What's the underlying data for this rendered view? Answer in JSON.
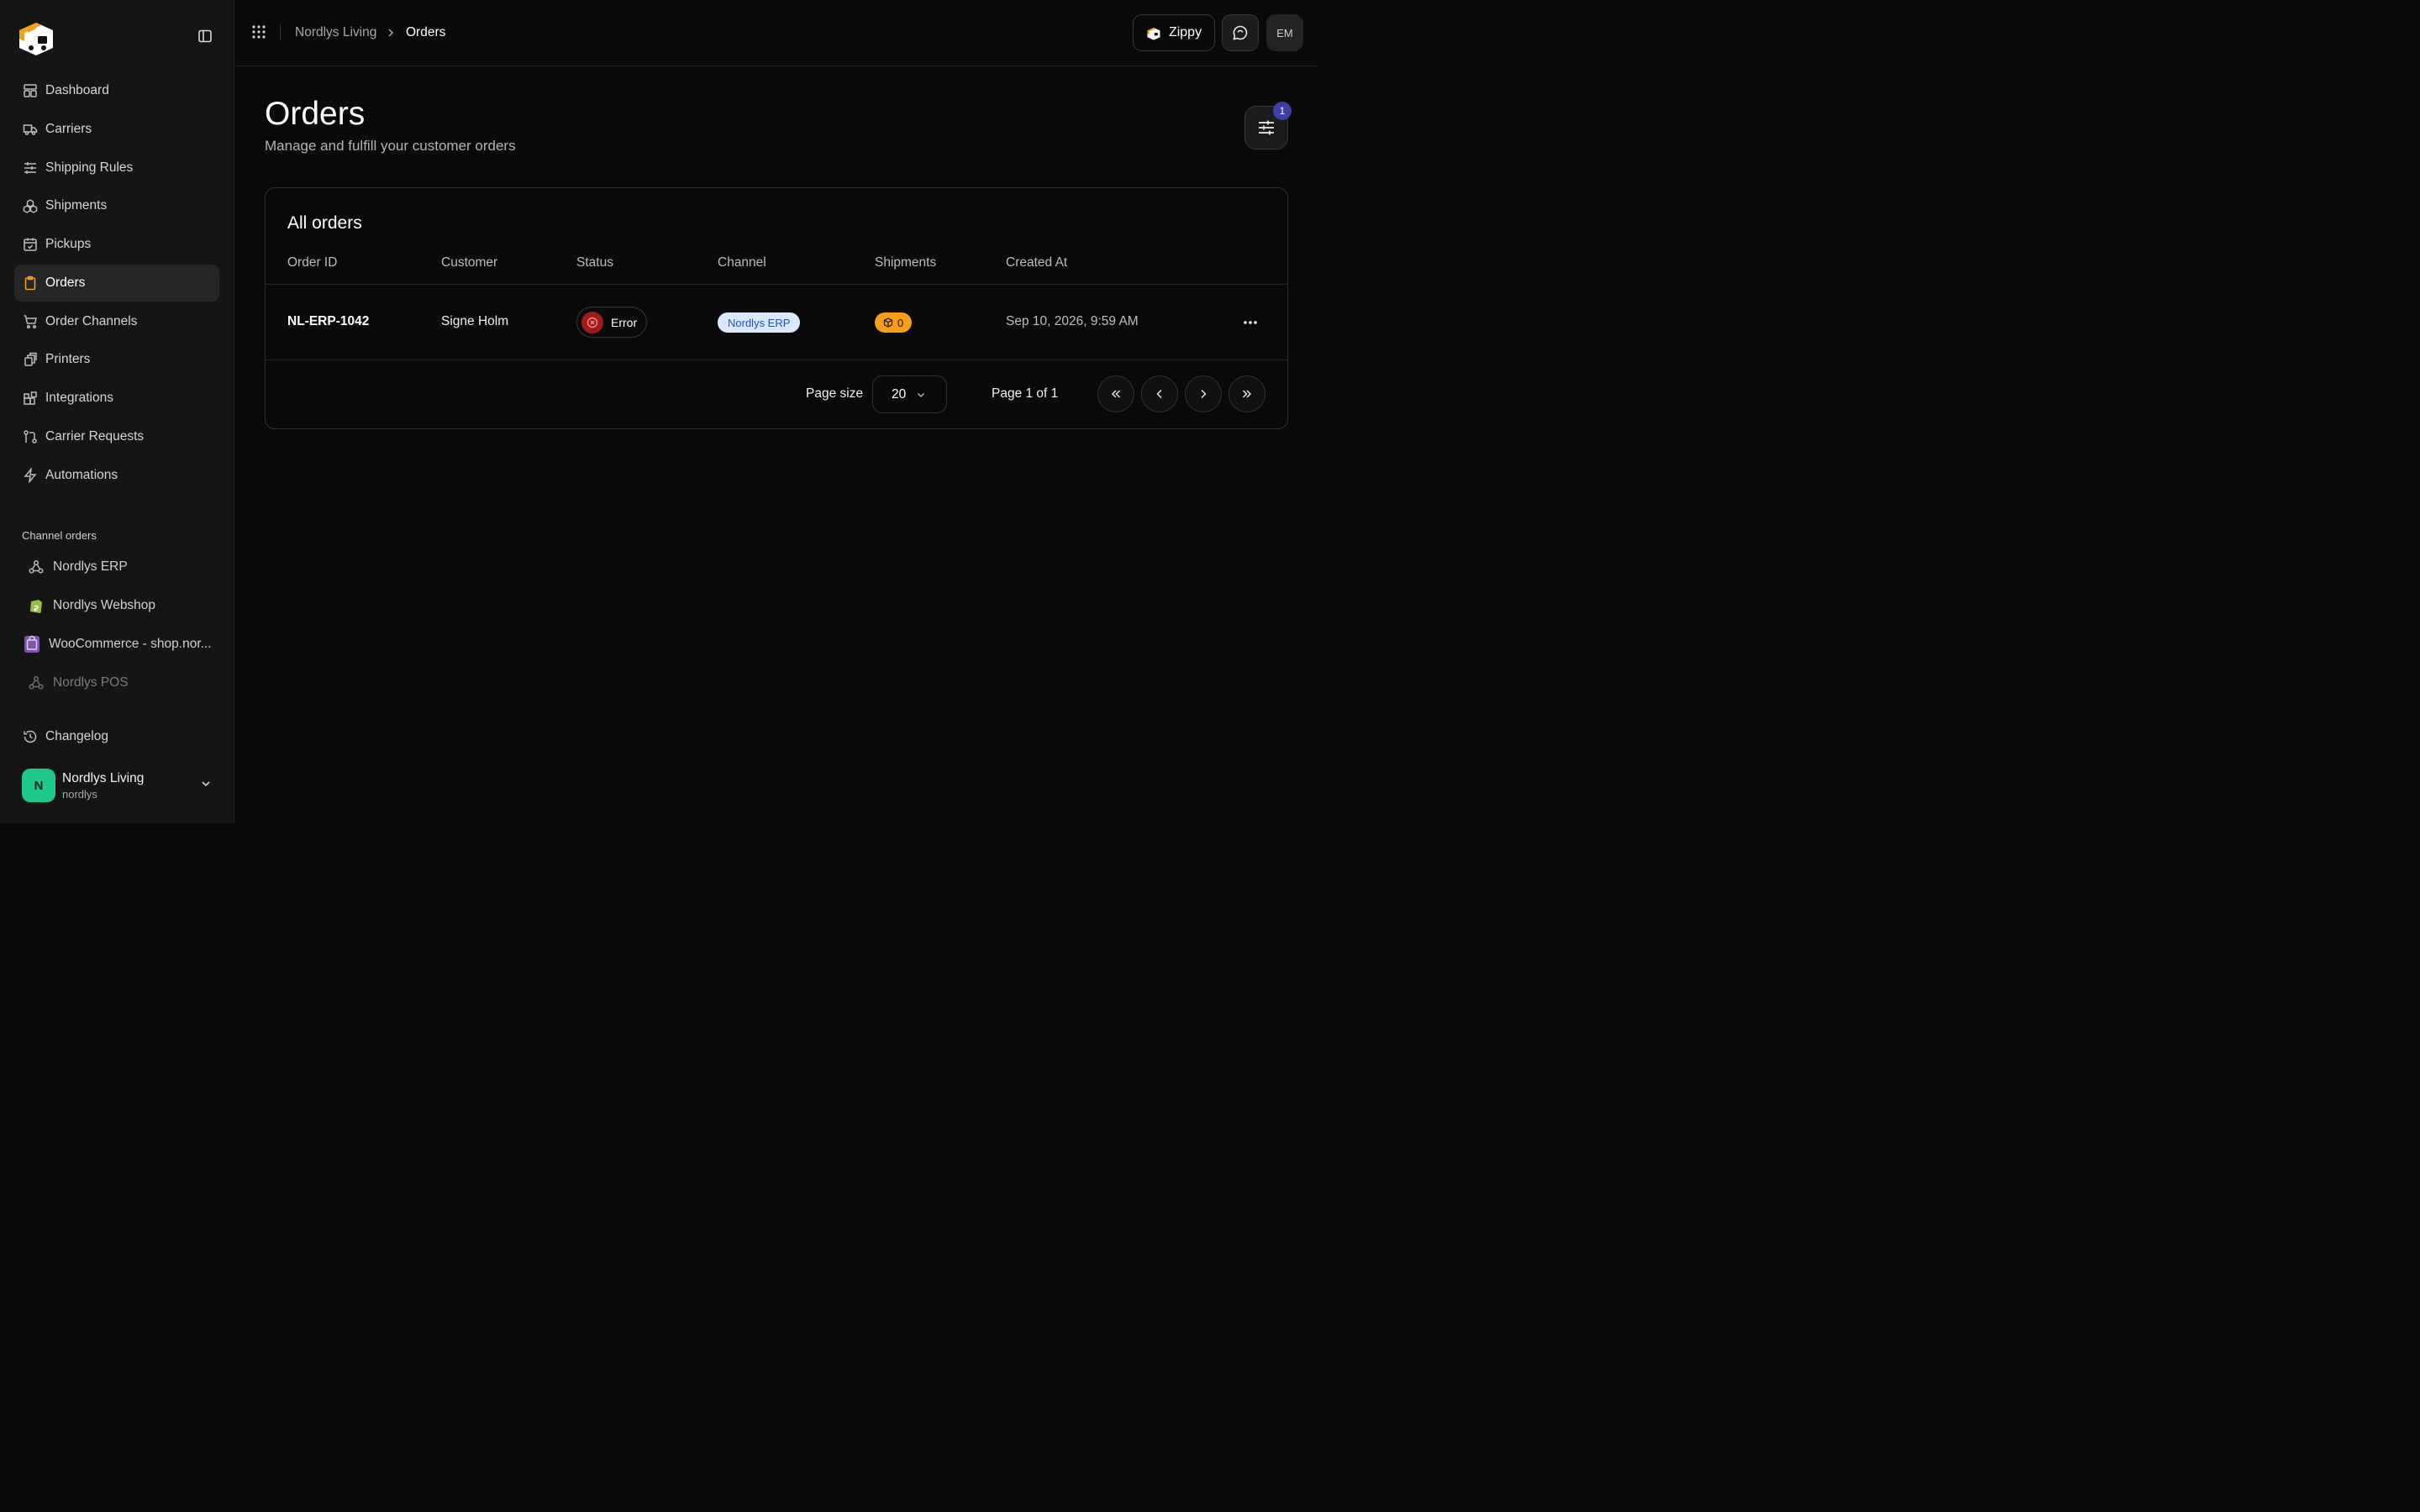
{
  "sidebar": {
    "toggle_icon": "sidebar-toggle-icon",
    "nav": [
      {
        "label": "Dashboard",
        "icon": "dashboard-icon"
      },
      {
        "label": "Carriers",
        "icon": "truck-icon"
      },
      {
        "label": "Shipping Rules",
        "icon": "sliders-icon"
      },
      {
        "label": "Shipments",
        "icon": "boxes-icon"
      },
      {
        "label": "Pickups",
        "icon": "calendar-check-icon"
      },
      {
        "label": "Orders",
        "icon": "clipboard-icon",
        "active": true
      },
      {
        "label": "Order Channels",
        "icon": "cart-icon"
      },
      {
        "label": "Printers",
        "icon": "printer-icon"
      },
      {
        "label": "Integrations",
        "icon": "blocks-icon"
      },
      {
        "label": "Carrier Requests",
        "icon": "git-pull-request-icon"
      },
      {
        "label": "Automations",
        "icon": "zap-icon"
      }
    ],
    "channel_section_label": "Channel orders",
    "channels": [
      {
        "label": "Nordlys ERP",
        "icon": "webhook-icon"
      },
      {
        "label": "Nordlys Webshop",
        "icon": "shopify-icon"
      },
      {
        "label": "WooCommerce - shop.nor...",
        "icon": "woocommerce-icon"
      },
      {
        "label": "Nordlys POS",
        "icon": "webhook-icon"
      }
    ],
    "changelog_label": "Changelog",
    "account": {
      "initial": "N",
      "name": "Nordlys Living",
      "handle": "nordlys",
      "avatar_color": "#1fc98a"
    }
  },
  "topbar": {
    "breadcrumb": [
      "Nordlys Living",
      "Orders"
    ],
    "app_button_label": "Zippy",
    "user_initials": "EM"
  },
  "page": {
    "title": "Orders",
    "subtitle": "Manage and fulfill your customer orders",
    "filter_count": "1"
  },
  "table": {
    "title": "All orders",
    "columns": [
      "Order ID",
      "Customer",
      "Status",
      "Channel",
      "Shipments",
      "Created At"
    ],
    "rows": [
      {
        "order_id": "NL-ERP-1042",
        "customer": "Signe Holm",
        "status": "Error",
        "channel": "Nordlys ERP",
        "shipments": "0",
        "created_at": "Sep 10, 2026, 9:59 AM"
      }
    ]
  },
  "pagination": {
    "page_size_label": "Page size",
    "page_size": "20",
    "page_info": "Page 1 of 1"
  },
  "colors": {
    "accent": "#f0a030",
    "error": "#a01c1c",
    "channel_badge_bg": "#dbe8ff",
    "shipments_badge_bg": "#f59e1b",
    "filter_badge_bg": "#3f3fa8"
  }
}
